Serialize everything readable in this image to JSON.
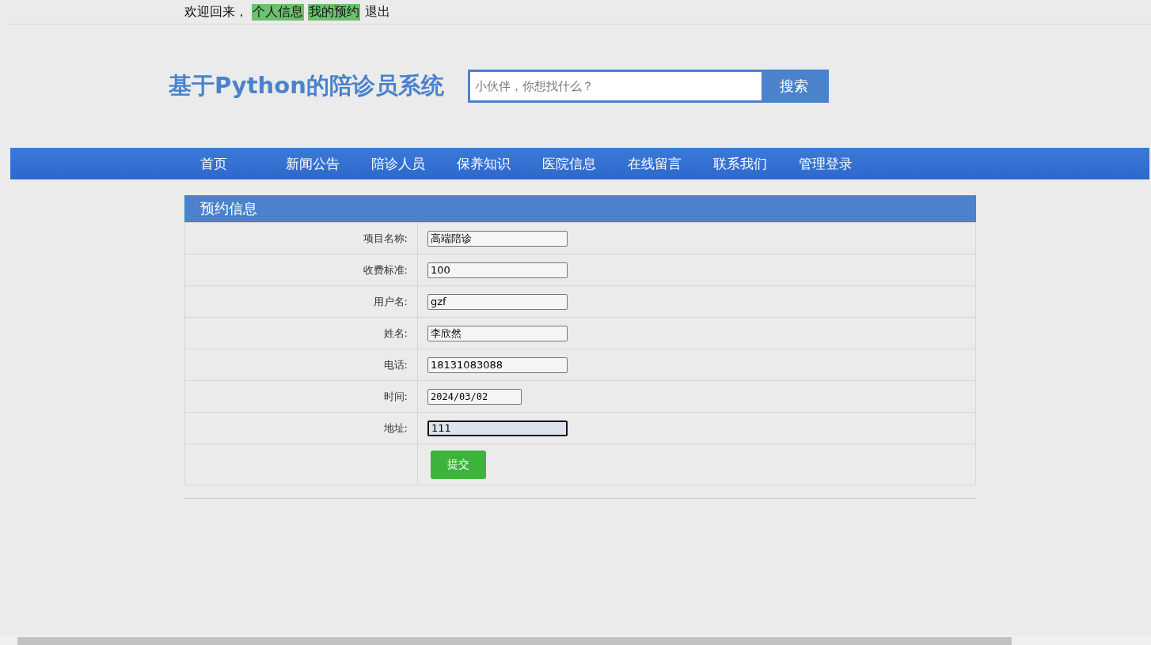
{
  "top_bar": {
    "greeting": "欢迎回来，",
    "links": [
      {
        "label": "个人信息",
        "highlighted": true
      },
      {
        "label": "我的预约",
        "highlighted": true
      },
      {
        "label": "退出",
        "highlighted": false
      }
    ]
  },
  "header": {
    "title": "基于Python的陪诊员系统",
    "search": {
      "placeholder": "小伙伴，你想找什么？",
      "button": "搜索"
    }
  },
  "nav": [
    {
      "label": "首页"
    },
    {
      "label": "新闻公告"
    },
    {
      "label": "陪诊人员"
    },
    {
      "label": "保养知识"
    },
    {
      "label": "医院信息"
    },
    {
      "label": "在线留言"
    },
    {
      "label": "联系我们"
    },
    {
      "label": "管理登录"
    }
  ],
  "panel": {
    "title": "预约信息",
    "fields": [
      {
        "label": "项目名称:",
        "kind": "text",
        "value": "高端陪诊",
        "focused": false
      },
      {
        "label": "收费标准:",
        "kind": "text",
        "value": "100",
        "focused": false
      },
      {
        "label": "用户名:",
        "kind": "text",
        "value": "gzf",
        "focused": false
      },
      {
        "label": "姓名:",
        "kind": "text",
        "value": "李欣然",
        "focused": false
      },
      {
        "label": "电话:",
        "kind": "text",
        "value": "18131083088",
        "focused": false
      },
      {
        "label": "时间:",
        "kind": "date",
        "value": "2024/03/02",
        "focused": false
      },
      {
        "label": "地址:",
        "kind": "text",
        "value": "111",
        "focused": true
      }
    ],
    "submit": "提交"
  }
}
